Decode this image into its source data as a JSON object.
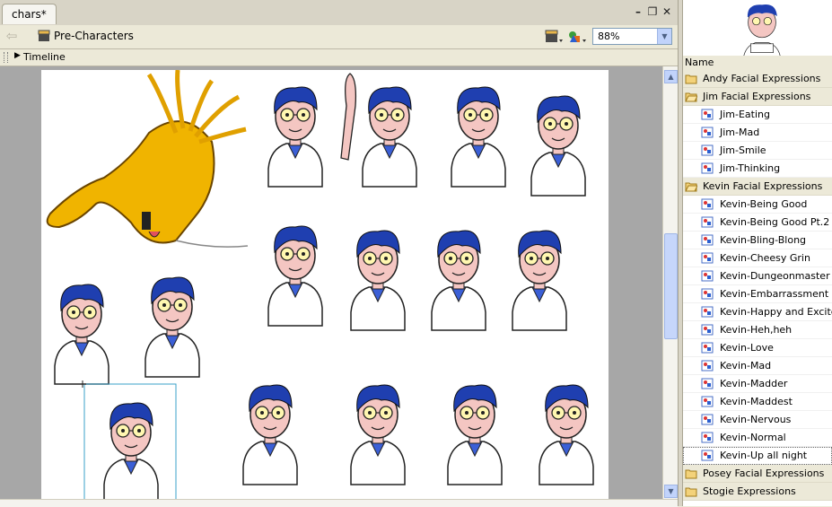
{
  "document": {
    "tab_title": "chars*"
  },
  "toolbar": {
    "scene": "Pre-Characters",
    "zoom": "88%"
  },
  "timeline": {
    "label": "Timeline"
  },
  "library": {
    "column_name": "Name",
    "rows": [
      {
        "label": "Andy Facial Expressions",
        "kind": "folder",
        "open": false
      },
      {
        "label": "Jim Facial Expressions",
        "kind": "folder",
        "open": true
      },
      {
        "label": "Jim-Eating",
        "kind": "item"
      },
      {
        "label": "Jim-Mad",
        "kind": "item"
      },
      {
        "label": "Jim-Smile",
        "kind": "item"
      },
      {
        "label": "Jim-Thinking",
        "kind": "item"
      },
      {
        "label": "Kevin Facial Expressions",
        "kind": "folder",
        "open": true
      },
      {
        "label": "Kevin-Being Good",
        "kind": "item"
      },
      {
        "label": "Kevin-Being Good Pt.2",
        "kind": "item"
      },
      {
        "label": "Kevin-Bling-Blong",
        "kind": "item"
      },
      {
        "label": "Kevin-Cheesy Grin",
        "kind": "item"
      },
      {
        "label": "Kevin-Dungeonmaster",
        "kind": "item"
      },
      {
        "label": "Kevin-Embarrassment (dec",
        "kind": "item"
      },
      {
        "label": "Kevin-Happy and Excited",
        "kind": "item"
      },
      {
        "label": "Kevin-Heh,heh",
        "kind": "item"
      },
      {
        "label": "Kevin-Love",
        "kind": "item"
      },
      {
        "label": "Kevin-Mad",
        "kind": "item"
      },
      {
        "label": "Kevin-Madder",
        "kind": "item"
      },
      {
        "label": "Kevin-Maddest",
        "kind": "item"
      },
      {
        "label": "Kevin-Nervous",
        "kind": "item"
      },
      {
        "label": "Kevin-Normal",
        "kind": "item"
      },
      {
        "label": "Kevin-Up all night",
        "kind": "item",
        "selected": true
      },
      {
        "label": "Posey Facial Expressions",
        "kind": "folder",
        "open": false
      },
      {
        "label": "Stogie Expressions",
        "kind": "folder",
        "open": false
      }
    ]
  },
  "colors": {
    "hair": "#1f3fb0",
    "skin": "#f4c6c2",
    "shirt_blue": "#3b5fd6",
    "dog": "#f0b400"
  }
}
